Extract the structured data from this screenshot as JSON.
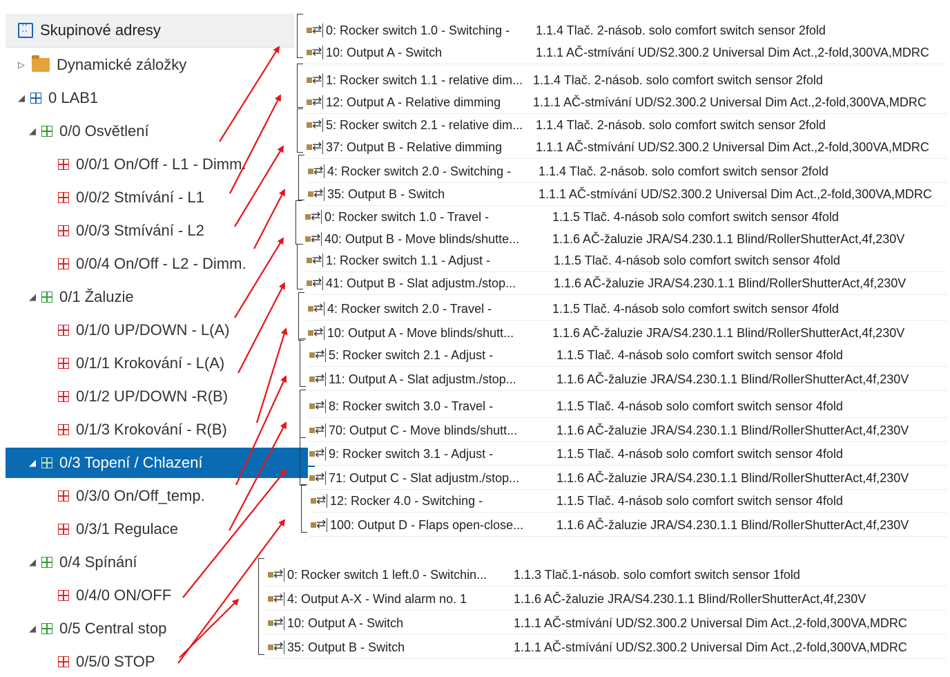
{
  "tree": {
    "header_label": "Skupinové adresy",
    "items": [
      {
        "label": "Dynamické záložky",
        "type": "folder",
        "expander": "▷"
      },
      {
        "label": "0 LAB1",
        "type": "group",
        "color": "#1a64b8",
        "expander": "◢"
      },
      {
        "label": "0/0 Osvětlení",
        "type": "group",
        "color": "#2e9a2e",
        "expander": "◢"
      },
      {
        "label": "0/0/1 On/Off - L1 - Dimm.",
        "type": "address",
        "color": "#d8262b"
      },
      {
        "label": "0/0/2 Stmívání - L1",
        "type": "address",
        "color": "#d8262b"
      },
      {
        "label": "0/0/3 Stmívání - L2",
        "type": "address",
        "color": "#d8262b"
      },
      {
        "label": "0/0/4 On/Off - L2 - Dimm.",
        "type": "address",
        "color": "#d8262b"
      },
      {
        "label": "0/1 Žaluzie",
        "type": "group",
        "color": "#2e9a2e",
        "expander": "◢"
      },
      {
        "label": "0/1/0 UP/DOWN - L(A)",
        "type": "address",
        "color": "#d8262b"
      },
      {
        "label": "0/1/1 Krokování - L(A)",
        "type": "address",
        "color": "#d8262b"
      },
      {
        "label": "0/1/2 UP/DOWN -R(B)",
        "type": "address",
        "color": "#d8262b"
      },
      {
        "label": "0/1/3 Krokování - R(B)",
        "type": "address",
        "color": "#d8262b"
      },
      {
        "label": "0/3 Topení / Chlazení",
        "type": "group",
        "color": "#2e9a2e",
        "expander": "◢",
        "selected": true
      },
      {
        "label": "0/3/0 On/Off_temp.",
        "type": "address",
        "color": "#d8262b"
      },
      {
        "label": "0/3/1 Regulace",
        "type": "address",
        "color": "#d8262b"
      },
      {
        "label": "0/4 Spínání",
        "type": "group",
        "color": "#2e9a2e",
        "expander": "◢"
      },
      {
        "label": "0/4/0 ON/OFF",
        "type": "address",
        "color": "#d8262b"
      },
      {
        "label": "0/5 Central stop",
        "type": "group",
        "color": "#2e9a2e",
        "expander": "◢"
      },
      {
        "label": "0/5/0 STOP",
        "type": "address",
        "color": "#d8262b"
      }
    ]
  },
  "object_groups": [
    {
      "rows": [
        {
          "name": "0: Rocker switch 1.0 - Switching -",
          "device": "1.1.4 Tlač. 2-násob. solo comfort switch sensor 2fold"
        },
        {
          "name": "10: Output A - Switch",
          "device": "1.1.1 AČ-stmívání UD/S2.300.2 Universal Dim Act.,2-fold,300VA,MDRC"
        }
      ]
    },
    {
      "rows": [
        {
          "name": "1: Rocker switch 1.1 - relative dim...",
          "device": "1.1.4 Tlač. 2-násob. solo comfort switch sensor 2fold"
        },
        {
          "name": "12: Output A - Relative dimming",
          "device": "1.1.1 AČ-stmívání UD/S2.300.2 Universal Dim Act.,2-fold,300VA,MDRC"
        }
      ]
    },
    {
      "rows": [
        {
          "name": "5: Rocker switch 2.1 - relative dim...",
          "device": "1.1.4 Tlač. 2-násob. solo comfort switch sensor 2fold"
        },
        {
          "name": "37: Output B - Relative dimming",
          "device": "1.1.1 AČ-stmívání UD/S2.300.2 Universal Dim Act.,2-fold,300VA,MDRC"
        }
      ]
    },
    {
      "rows": [
        {
          "name": "4: Rocker switch 2.0 - Switching -",
          "device": "1.1.4 Tlač. 2-násob. solo comfort switch sensor 2fold"
        },
        {
          "name": "35: Output B - Switch",
          "device": "1.1.1 AČ-stmívání UD/S2.300.2 Universal Dim Act.,2-fold,300VA,MDRC"
        }
      ]
    },
    {
      "rows": [
        {
          "name": "0: Rocker switch 1.0 - Travel -",
          "device": "1.1.5 Tlač. 4-násob solo comfort switch sensor 4fold"
        },
        {
          "name": "40: Output B - Move blinds/shutte...",
          "device": "1.1.6 AČ-žaluzie JRA/S4.230.1.1 Blind/RollerShutterAct,4f,230V"
        }
      ]
    },
    {
      "rows": [
        {
          "name": "1: Rocker switch 1.1 - Adjust -",
          "device": "1.1.5 Tlač. 4-násob solo comfort switch sensor 4fold"
        },
        {
          "name": "41: Output B - Slat adjustm./stop...",
          "device": "1.1.6 AČ-žaluzie JRA/S4.230.1.1 Blind/RollerShutterAct,4f,230V"
        }
      ]
    },
    {
      "rows": [
        {
          "name": "4: Rocker switch 2.0 - Travel -",
          "device": "1.1.5 Tlač. 4-násob solo comfort switch sensor 4fold"
        },
        {
          "name": "10: Output A - Move blinds/shutt...",
          "device": "1.1.6 AČ-žaluzie JRA/S4.230.1.1 Blind/RollerShutterAct,4f,230V"
        }
      ]
    },
    {
      "rows": [
        {
          "name": "5: Rocker switch 2.1 - Adjust -",
          "device": "1.1.5 Tlač. 4-násob solo comfort switch sensor 4fold"
        },
        {
          "name": "11: Output A - Slat adjustm./stop...",
          "device": "1.1.6 AČ-žaluzie JRA/S4.230.1.1 Blind/RollerShutterAct,4f,230V"
        }
      ]
    },
    {
      "rows": [
        {
          "name": "8: Rocker switch 3.0 - Travel -",
          "device": "1.1.5 Tlač. 4-násob solo comfort switch sensor 4fold"
        },
        {
          "name": "70: Output C - Move blinds/shutt...",
          "device": "1.1.6 AČ-žaluzie JRA/S4.230.1.1 Blind/RollerShutterAct,4f,230V"
        }
      ]
    },
    {
      "rows": [
        {
          "name": "9: Rocker switch 3.1 - Adjust -",
          "device": "1.1.5 Tlač. 4-násob solo comfort switch sensor 4fold"
        },
        {
          "name": "71: Output C - Slat adjustm./stop...",
          "device": "1.1.6 AČ-žaluzie JRA/S4.230.1.1 Blind/RollerShutterAct,4f,230V"
        }
      ]
    },
    {
      "rows": [
        {
          "name": "12: Rocker 4.0 - Switching -",
          "device": "1.1.5 Tlač. 4-násob solo comfort switch sensor 4fold"
        },
        {
          "name": "100: Output D - Flaps open-close...",
          "device": "1.1.6 AČ-žaluzie JRA/S4.230.1.1 Blind/RollerShutterAct,4f,230V"
        }
      ]
    },
    {
      "rows": [
        {
          "name": "0: Rocker switch 1 left.0 - Switchin...",
          "device": "1.1.3 Tlač.1-násob. solo comfort switch sensor 1fold"
        },
        {
          "name": "4: Output A-X - Wind alarm no. 1",
          "device": "1.1.6 AČ-žaluzie JRA/S4.230.1.1 Blind/RollerShutterAct,4f,230V"
        },
        {
          "name": "10: Output A - Switch",
          "device": "1.1.1 AČ-stmívání UD/S2.300.2 Universal Dim Act.,2-fold,300VA,MDRC"
        },
        {
          "name": "35: Output B - Switch",
          "device": "1.1.1 AČ-stmívání UD/S2.300.2 Universal Dim Act.,2-fold,300VA,MDRC"
        }
      ]
    }
  ],
  "arrow_color": "#e8141a"
}
